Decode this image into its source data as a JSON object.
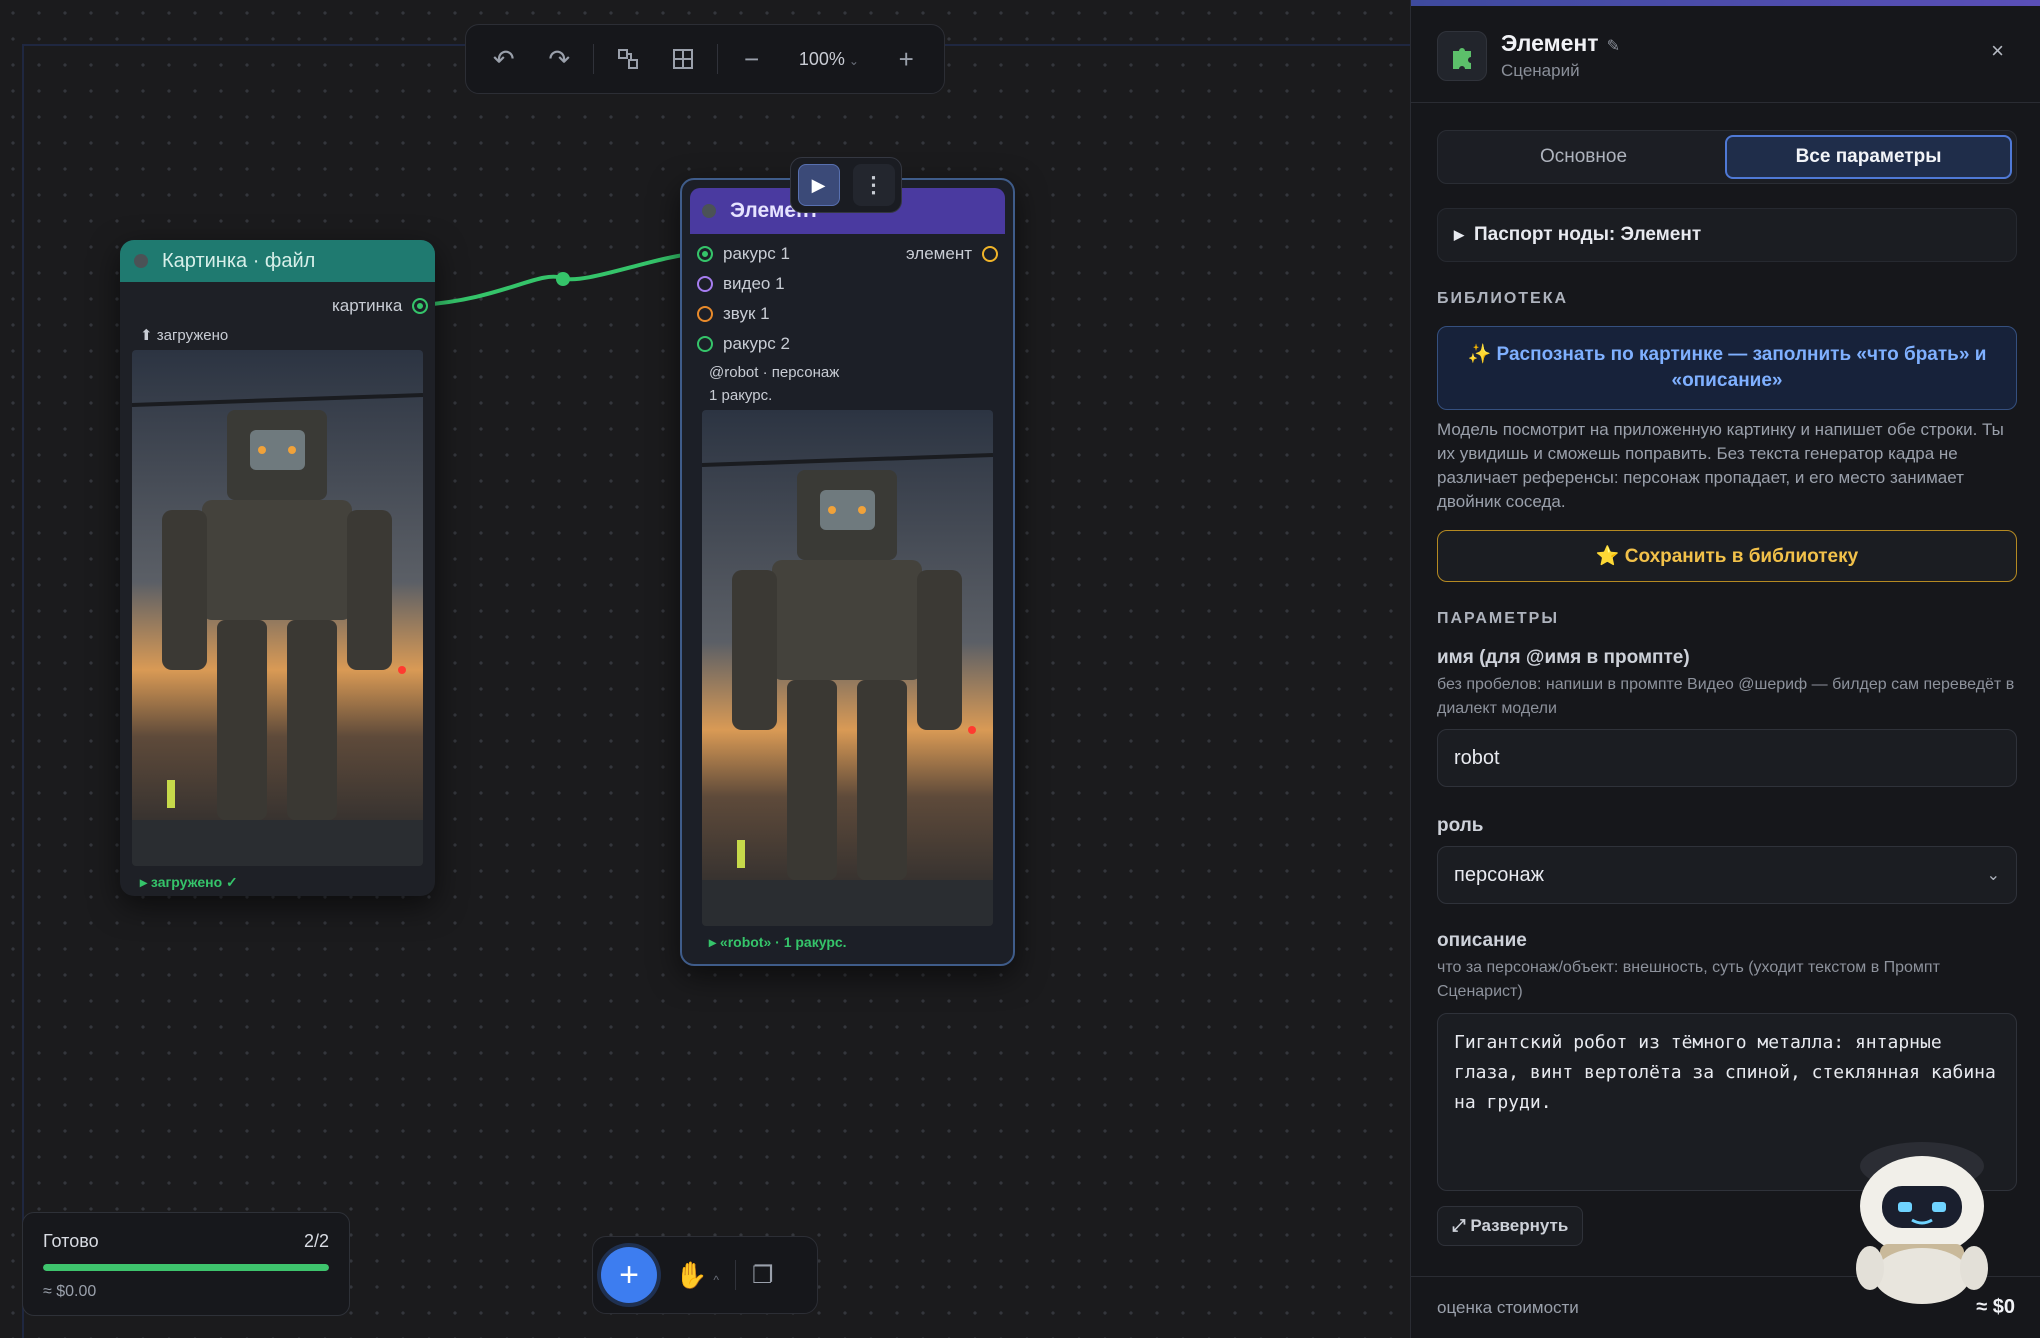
{
  "canvas": {
    "toolbar": {
      "undo_icon": "undo-icon",
      "redo_icon": "redo-icon",
      "zoom_level": "100%",
      "zoom_caret": "⌄",
      "minus_icon": "minus-icon",
      "plus_icon": "plus-icon"
    },
    "image_node": {
      "title": "Картинка · файл",
      "output_port": "картинка",
      "upload_status": "⬆ загружено",
      "footer_status": "▸ загружено ✓"
    },
    "element_node": {
      "title": "Элемент",
      "inputs": [
        "ракурс 1",
        "видео 1",
        "звук 1",
        "ракурс 2"
      ],
      "output_port": "элемент",
      "meta_line1": "@robot · персонаж",
      "meta_line2": "1 ракурс.",
      "footer_status": "▸ «robot» · 1 ракурс."
    },
    "status": {
      "label": "Готово",
      "count": "2/2",
      "progress": 1.0,
      "cost": "≈ $0.00"
    }
  },
  "panel": {
    "title": "Элемент",
    "pencil": "✎",
    "subtitle": "Сценарий",
    "close": "×",
    "tabs": [
      "Основное",
      "Все параметры"
    ],
    "active_tab": 1,
    "passport": "Паспорт ноды: Элемент",
    "library_label": "БИБЛИОТЕКА",
    "recognize_button": "✨ Распознать по картинке — заполнить «что брать» и «описание»",
    "recognize_help": "Модель посмотрит на приложенную картинку и напишет обе строки. Ты их увидишь и сможешь поправить. Без текста генератор кадра не различает референсы: персонаж пропадает, и его место занимает двойник соседа.",
    "save_button": "⭐ Сохранить в библиотеку",
    "params_label": "ПАРАМЕТРЫ",
    "name_label": "имя (для @имя в промпте)",
    "name_hint": "без пробелов: напиши в промпте Видео @шериф — билдер сам переведёт в диалект модели",
    "name_value": "robot",
    "role_label": "роль",
    "role_value": "персонаж",
    "desc_label": "описание",
    "desc_hint": "что за персонаж/объект: внешность, суть (уходит текстом в Промпт Сценарист)",
    "desc_value": "Гигантский робот из тёмного металла: янтарные глаза, винт вертолёта за спиной, стеклянная кабина на груди.",
    "expand_button": "⤢ Развернуть",
    "cost_label": "оценка стоимости",
    "cost_value": "≈ $0"
  },
  "colors": {
    "accent": "#3d7df0",
    "image_node_header": "#1f7a70",
    "element_node_header": "#4a3aa0",
    "success": "#35c46a",
    "warning": "#f2c14a"
  }
}
